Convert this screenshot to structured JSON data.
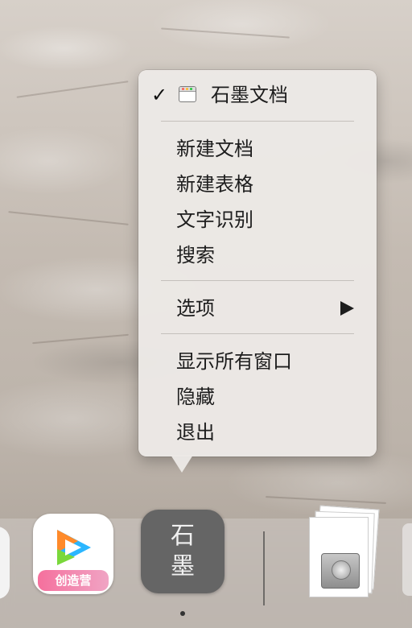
{
  "menu": {
    "app_title": "石墨文档",
    "app_checked": true,
    "group1": [
      "新建文档",
      "新建表格",
      "文字识别",
      "搜索"
    ],
    "options_label": "选项",
    "group3": [
      "显示所有窗口",
      "隐藏",
      "退出"
    ]
  },
  "dock": {
    "tencent_banner": "创造营",
    "shimo_line1": "石",
    "shimo_line2": "墨"
  },
  "icons": {
    "check": "checkmark-icon",
    "window": "app-window-icon",
    "submenu": "triangle-right-icon"
  },
  "colors": {
    "menu_bg": "#ECE9E6",
    "shimo_icon_bg": "#656565",
    "tencent_banner": "#F5709D"
  }
}
